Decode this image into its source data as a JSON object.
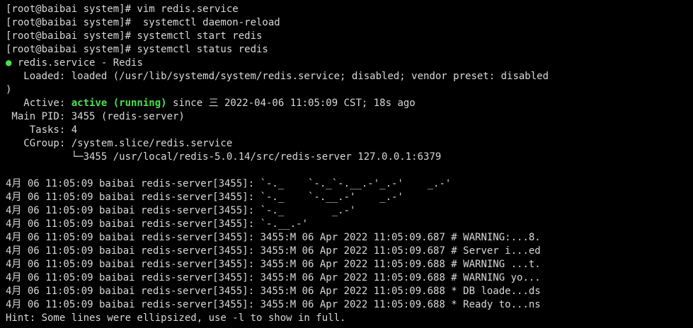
{
  "terminal": {
    "colors": {
      "background": "#000000",
      "text": "#d8d8d8",
      "status_green": "#4be04b"
    },
    "lines": [
      "[root@baibai system]# vim redis.service",
      "[root@baibai system]#  systemctl daemon-reload",
      "[root@baibai system]# systemctl start redis",
      "[root@baibai system]# systemctl status redis",
      "",
      "   Loaded: loaded (/usr/lib/systemd/system/redis.service; disabled; vendor preset: disabled",
      ")",
      "",
      " Main PID: 3455 (redis-server)",
      "    Tasks: 4",
      "   CGroup: /system.slice/redis.service",
      "           └─3455 /usr/local/redis-5.0.14/src/redis-server 127.0.0.1:6379",
      "",
      "4月 06 11:05:09 baibai redis-server[3455]: `-._    `-._`-.__.-'_.-'    _.-'",
      "4月 06 11:05:09 baibai redis-server[3455]: `-._    `-.__.-'    _.-'",
      "4月 06 11:05:09 baibai redis-server[3455]: `-._        _.-'",
      "4月 06 11:05:09 baibai redis-server[3455]: `-.__.-'",
      "4月 06 11:05:09 baibai redis-server[3455]: 3455:M 06 Apr 2022 11:05:09.687 # WARNING:...8.",
      "4月 06 11:05:09 baibai redis-server[3455]: 3455:M 06 Apr 2022 11:05:09.687 # Server i...ed",
      "4月 06 11:05:09 baibai redis-server[3455]: 3455:M 06 Apr 2022 11:05:09.688 # WARNING ...t.",
      "4月 06 11:05:09 baibai redis-server[3455]: 3455:M 06 Apr 2022 11:05:09.688 # WARNING yo...",
      "4月 06 11:05:09 baibai redis-server[3455]: 3455:M 06 Apr 2022 11:05:09.688 * DB loade...ds",
      "4月 06 11:05:09 baibai redis-server[3455]: 3455:M 06 Apr 2022 11:05:09.688 * Ready to...ns",
      "Hint: Some lines were ellipsized, use -l to show in full."
    ],
    "service_header": {
      "dot": "●",
      "text": " redis.service - Redis"
    },
    "active_line": {
      "label": "   Active: ",
      "state": "active (running)",
      "rest": " since 三 2022-04-06 11:05:09 CST; 18s ago"
    }
  }
}
